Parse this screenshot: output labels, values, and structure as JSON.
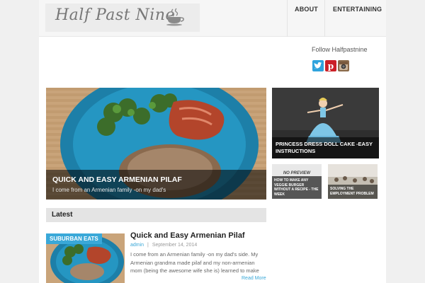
{
  "site": {
    "logo_text": "Half Past Nine",
    "nav": [
      {
        "label": "ABOUT"
      },
      {
        "label": "ENTERTAINING"
      }
    ]
  },
  "sidebar": {
    "follow_label": "Follow Halfpastnine",
    "social": [
      {
        "name": "twitter-icon",
        "color": "#2fa3dd"
      },
      {
        "name": "pinterest-icon",
        "color": "#cb2027"
      },
      {
        "name": "instagram-icon",
        "color": "#8a6a4a"
      }
    ]
  },
  "featured": {
    "main": {
      "title": "QUICK AND EASY ARMENIAN PILAF",
      "excerpt": "I come from an Armenian family -on my dad's"
    },
    "right": {
      "title": "PRINCESS DRESS DOLL CAKE -EASY INSTRUCTIONS"
    },
    "small": [
      {
        "badge": "NO PREVIEW",
        "title": "HOW TO MAKE ANY VEGGIE BURGER WITHOUT A RECIPE - THE WEEK"
      },
      {
        "title": "SOLVING THE EMPLOYMENT PROBLEM"
      }
    ]
  },
  "latest": {
    "heading": "Latest",
    "posts": [
      {
        "category": "SUBURBAN EATS",
        "title": "Quick and Easy Armenian Pilaf",
        "author": "admin",
        "separator": "|",
        "date": "September 14, 2014",
        "excerpt": "I come from an Armenian family -on my dad's side. My Armenian grandma made pilaf and my non-armenian mom (being the awesome wife she is) learned to make",
        "read_more": "Read More"
      }
    ]
  }
}
